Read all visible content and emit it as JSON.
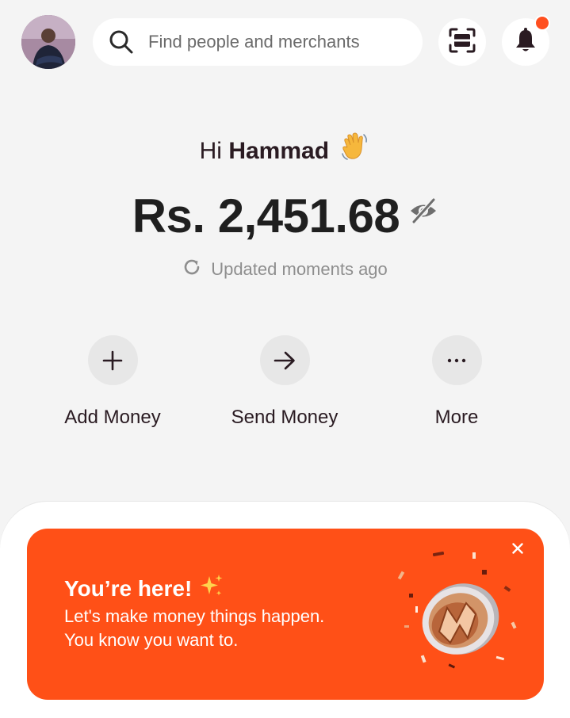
{
  "header": {
    "search_placeholder": "Find people and merchants",
    "notification_dot_color": "#ff4f1f",
    "icons": [
      "avatar",
      "search-icon",
      "scan-icon",
      "bell-icon"
    ]
  },
  "wallet": {
    "greeting_prefix": "Hi",
    "user_name": "Hammad",
    "greeting_emoji": "waving-hand-icon",
    "balance": "Rs. 2,451.68",
    "balance_visibility_icon": "eye-off-icon",
    "updated_text": "Updated moments ago"
  },
  "actions": [
    {
      "label": "Add Money",
      "icon": "plus-icon"
    },
    {
      "label": "Send Money",
      "icon": "arrow-right-icon"
    },
    {
      "label": "More",
      "icon": "more-dots-icon"
    }
  ],
  "promo": {
    "title": "You’re here!",
    "line1": "Let's make money things happen.",
    "line2": "You know you want to.",
    "background_color": "#ff5017",
    "close_icon": "close-icon",
    "illustration": "coin-icon"
  }
}
